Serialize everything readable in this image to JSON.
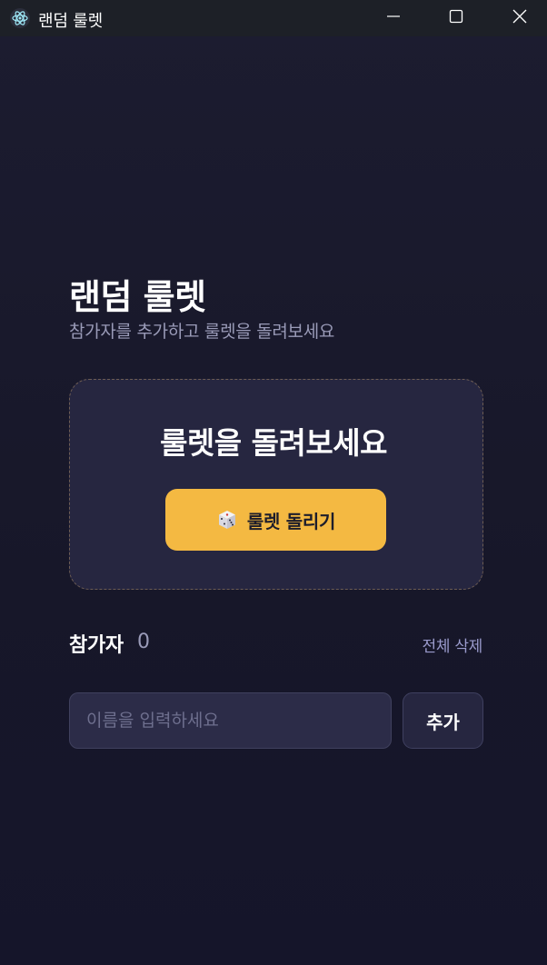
{
  "window": {
    "title": "랜덤 룰렛",
    "icon": "electron-atom-icon"
  },
  "header": {
    "title": "랜덤 룰렛",
    "subtitle": "참가자를 추가하고 룰렛을 돌려보세요"
  },
  "roulette": {
    "title": "룰렛을 돌려보세요",
    "spin_label": "룰렛 돌리기",
    "spin_icon": "dice-icon"
  },
  "participants": {
    "label": "참가자",
    "count": "0",
    "clear_all_label": "전체 삭제"
  },
  "input": {
    "value": "",
    "placeholder": "이름을 입력하세요",
    "add_label": "추가"
  },
  "colors": {
    "background": "#1a1a2e",
    "card": "#262640",
    "accent": "#f4b942",
    "muted_text": "#9a9bb8"
  }
}
